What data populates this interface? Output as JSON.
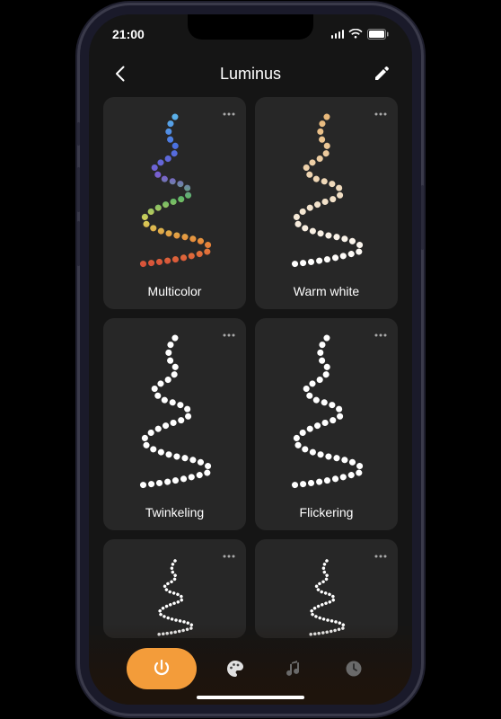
{
  "statusBar": {
    "time": "21:00"
  },
  "header": {
    "title": "Luminus"
  },
  "cards": [
    {
      "label": "Multicolor"
    },
    {
      "label": "Warm white"
    },
    {
      "label": "Twinkeling"
    },
    {
      "label": "Flickering"
    }
  ],
  "tabs": {
    "items": [
      "power",
      "palette",
      "music",
      "timer"
    ],
    "activeIndex": 0
  },
  "colors": {
    "accent": "#f39c3a",
    "cardBg": "#272727",
    "screenBg": "#151515"
  }
}
